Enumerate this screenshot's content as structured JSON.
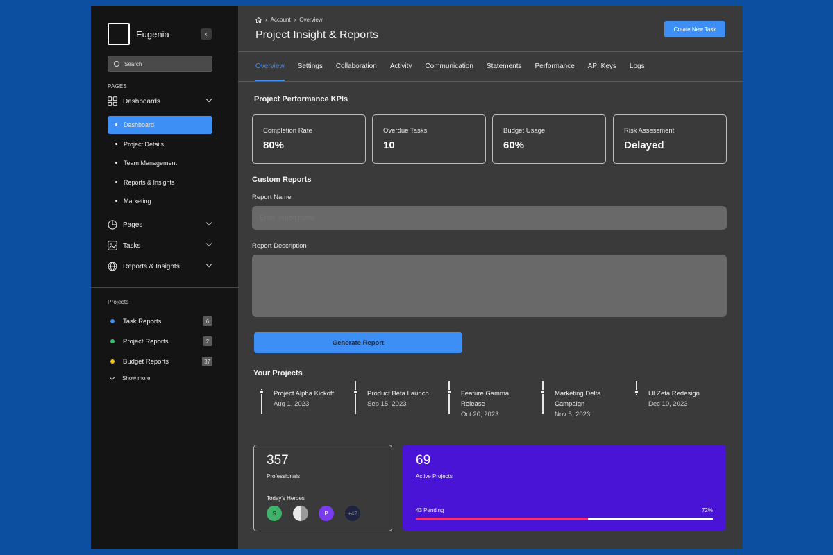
{
  "sidebar": {
    "brand": "Eugenia",
    "search_placeholder": "Search",
    "pages_label": "PAGES",
    "dashboards": {
      "label": "Dashboards",
      "items": [
        "Dashboard",
        "Project Details",
        "Team Management",
        "Reports & Insights",
        "Marketing"
      ]
    },
    "nav": [
      {
        "label": "Pages",
        "icon": "pie-chart-icon"
      },
      {
        "label": "Tasks",
        "icon": "image-icon"
      },
      {
        "label": "Reports & Insights",
        "icon": "globe-icon"
      }
    ],
    "projects_label": "Projects",
    "projects": [
      {
        "label": "Task Reports",
        "count": "6",
        "color": "#3d8ef5"
      },
      {
        "label": "Project Reports",
        "count": "2",
        "color": "#35c46b"
      },
      {
        "label": "Budget Reports",
        "count": "37",
        "color": "#f4c20d"
      }
    ],
    "show_more": "Show more"
  },
  "header": {
    "breadcrumb": [
      "Account",
      "Overview"
    ],
    "title": "Project Insight & Reports",
    "create_button": "Create New Task"
  },
  "tabs": [
    "Overview",
    "Settings",
    "Collaboration",
    "Activity",
    "Communication",
    "Statements",
    "Performance",
    "API Keys",
    "Logs"
  ],
  "kpis": {
    "title": "Project Performance KPIs",
    "items": [
      {
        "label": "Completion Rate",
        "value": "80%"
      },
      {
        "label": "Overdue Tasks",
        "value": "10"
      },
      {
        "label": "Budget Usage",
        "value": "60%"
      },
      {
        "label": "Risk Assessment",
        "value": "Delayed"
      }
    ]
  },
  "custom_reports": {
    "title": "Custom Reports",
    "name_label": "Report Name",
    "name_placeholder": "Enter  report name",
    "description_label": "Report Description",
    "generate_button": "Generate Report"
  },
  "projects": {
    "title": "Your Projects",
    "items": [
      {
        "name": "Project Alpha Kickoff",
        "date": "Aug 1, 2023"
      },
      {
        "name": "Product Beta Launch",
        "date": "Sep 15, 2023"
      },
      {
        "name": "Feature Gamma Release",
        "date": "Oct 20, 2023"
      },
      {
        "name": "Marketing Delta Campaign",
        "date": "Nov 5, 2023"
      },
      {
        "name": "UI Zeta Redesign",
        "date": "Dec 10, 2023"
      }
    ]
  },
  "professionals": {
    "count": "357",
    "label": "Professionals",
    "heroes_label": "Today's Heroes",
    "avatars": [
      {
        "initial": "S",
        "color": "#3fb36b"
      },
      {
        "initial": "",
        "color": "#c9c9c9"
      },
      {
        "initial": "P",
        "color": "#7a3cf0"
      },
      {
        "initial": "+42",
        "color": "#1e2340"
      }
    ]
  },
  "active_projects": {
    "count": "69",
    "label": "Active Projects",
    "pending": "43 Pending",
    "percent_label": "72%",
    "progress": 0.58,
    "bg_color": "#4a14d6",
    "bar_color": "#f0337e"
  },
  "colors": {
    "accent": "#3d8ef5",
    "sidebar_bg": "#141414",
    "main_bg": "#3a3a3a",
    "page_bg": "#0c4ea0"
  }
}
